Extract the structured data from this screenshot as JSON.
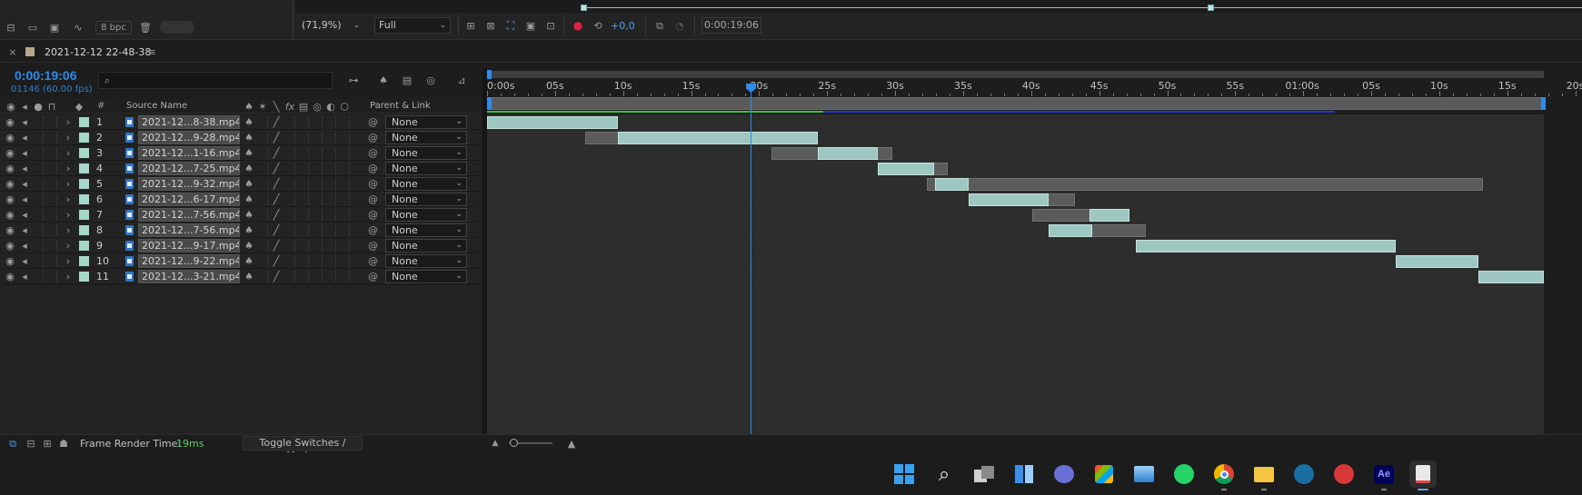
{
  "toolbar": {
    "bpc": "8 bpc",
    "zoom": "(71,9%)",
    "resolution": "Full",
    "exposure": "+0,0",
    "timecode": "0:00:19:06"
  },
  "tab": {
    "name": "2021-12-12 22-48-38"
  },
  "timeline": {
    "current_time": "0:00:19:06",
    "frame_info": "01146 (60.00 fps)",
    "search_placeholder": "",
    "columns": {
      "num": "#",
      "source_name": "Source Name",
      "parent_link": "Parent & Link"
    },
    "ruler_labels": [
      "0:00s",
      "05s",
      "10s",
      "15s",
      "20s",
      "25s",
      "30s",
      "35s",
      "40s",
      "45s",
      "50s",
      "55s",
      "01:00s",
      "05s",
      "10s",
      "15s",
      "20s"
    ],
    "layers": [
      {
        "num": "1",
        "name": "2021-12...8-38.mp4",
        "parent": "None",
        "full_start": 0,
        "full_end": 9.6,
        "act_start": 0,
        "act_end": 9.6
      },
      {
        "num": "2",
        "name": "2021-12...9-28.mp4",
        "parent": "None",
        "full_start": 7.2,
        "full_end": 24.3,
        "act_start": 9.6,
        "act_end": 24.3
      },
      {
        "num": "3",
        "name": "2021-12...1-16.mp4",
        "parent": "None",
        "full_start": 20.9,
        "full_end": 29.8,
        "act_start": 24.3,
        "act_end": 28.7
      },
      {
        "num": "4",
        "name": "2021-12...7-25.mp4",
        "parent": "None",
        "full_start": 28.7,
        "full_end": 33.9,
        "act_start": 28.7,
        "act_end": 32.9
      },
      {
        "num": "5",
        "name": "2021-12...9-32.mp4",
        "parent": "None",
        "full_start": 32.3,
        "full_end": 73.2,
        "act_start": 32.9,
        "act_end": 35.4
      },
      {
        "num": "6",
        "name": "2021-12...6-17.mp4",
        "parent": "None",
        "full_start": 35.4,
        "full_end": 43.2,
        "act_start": 35.4,
        "act_end": 41.3
      },
      {
        "num": "7",
        "name": "2021-12...7-56.mp4",
        "parent": "None",
        "full_start": 40.1,
        "full_end": 47.2,
        "act_start": 44.3,
        "act_end": 47.2
      },
      {
        "num": "8",
        "name": "2021-12...7-56.mp4",
        "parent": "None",
        "full_start": 41.3,
        "full_end": 48.4,
        "act_start": 41.3,
        "act_end": 44.5
      },
      {
        "num": "9",
        "name": "2021-12...9-17.mp4",
        "parent": "None",
        "full_start": 47.7,
        "full_end": 66.8,
        "act_start": 47.7,
        "act_end": 66.8
      },
      {
        "num": "10",
        "name": "2021-12...9-22.mp4",
        "parent": "None",
        "full_start": 66.8,
        "full_end": 72.9,
        "act_start": 66.8,
        "act_end": 72.9
      },
      {
        "num": "11",
        "name": "2021-12...3-21.mp4",
        "parent": "None",
        "full_start": 72.9,
        "full_end": 77.8,
        "act_start": 72.9,
        "act_end": 77.8
      }
    ]
  },
  "status": {
    "frame_render_label": "Frame Render Time:",
    "frame_render_value": "19ms",
    "toggle_label": "Toggle Switches / Modes"
  },
  "colors": {
    "accent": "#2d8ceb",
    "layer_label": "#a5d8c8",
    "bar_active": "#9fc7c2",
    "bar_inactive": "#5b5b5b",
    "render_value": "#5ecb62"
  },
  "taskbar": {
    "icons": [
      "windows-start-icon",
      "search-icon",
      "task-view-icon",
      "widgets-icon",
      "teams-chat-icon",
      "microsoft-store-icon",
      "photos-icon",
      "whatsapp-icon",
      "chrome-icon",
      "file-explorer-icon",
      "steam-icon",
      "red-app-icon",
      "after-effects-icon",
      "snipping-tool-icon"
    ],
    "ae_label": "Ae"
  }
}
